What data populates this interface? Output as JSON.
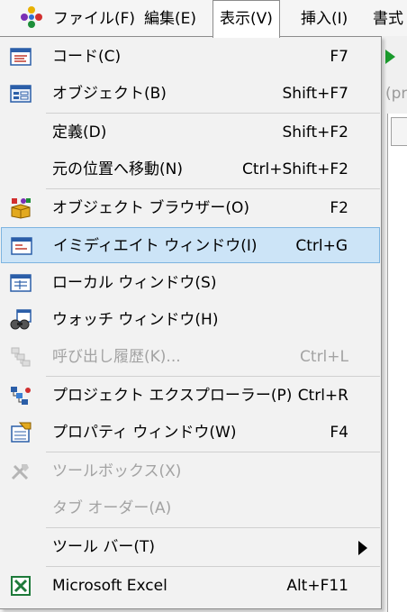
{
  "menubar": {
    "items": [
      "ファイル(F)",
      "編集(E)",
      "表示(V)",
      "挿入(I)",
      "書式"
    ]
  },
  "background": {
    "text": "(pr"
  },
  "menu": {
    "items": [
      {
        "label": "コード(C)",
        "shortcut": "F7",
        "icon": "code-window-icon"
      },
      {
        "label": "オブジェクト(B)",
        "shortcut": "Shift+F7",
        "icon": "object-window-icon"
      },
      {
        "label": "定義(D)",
        "shortcut": "Shift+F2"
      },
      {
        "label": "元の位置へ移動(N)",
        "shortcut": "Ctrl+Shift+F2"
      },
      {
        "label": "オブジェクト ブラウザー(O)",
        "shortcut": "F2",
        "icon": "object-browser-icon"
      },
      {
        "label": "イミディエイト ウィンドウ(I)",
        "shortcut": "Ctrl+G",
        "icon": "immediate-window-icon",
        "highlighted": true
      },
      {
        "label": "ローカル ウィンドウ(S)",
        "shortcut": "",
        "icon": "locals-window-icon"
      },
      {
        "label": "ウォッチ ウィンドウ(H)",
        "shortcut": "",
        "icon": "watch-window-icon"
      },
      {
        "label": "呼び出し履歴(K)...",
        "shortcut": "Ctrl+L",
        "icon": "call-stack-icon",
        "disabled": true
      },
      {
        "label": "プロジェクト エクスプローラー(P)",
        "shortcut": "Ctrl+R",
        "icon": "project-explorer-icon"
      },
      {
        "label": "プロパティ ウィンドウ(W)",
        "shortcut": "F4",
        "icon": "properties-window-icon"
      },
      {
        "label": "ツールボックス(X)",
        "shortcut": "",
        "icon": "toolbox-icon",
        "disabled": true
      },
      {
        "label": "タブ オーダー(A)",
        "shortcut": "",
        "disabled": true
      },
      {
        "label": "ツール バー(T)",
        "shortcut": "",
        "submenu": true
      },
      {
        "label": "Microsoft Excel",
        "shortcut": "Alt+F11",
        "icon": "excel-icon"
      }
    ]
  },
  "colors": {
    "highlight": "#cce4f7",
    "highlight_border": "#7db4e0",
    "disabled_text": "#a3a3a3"
  }
}
